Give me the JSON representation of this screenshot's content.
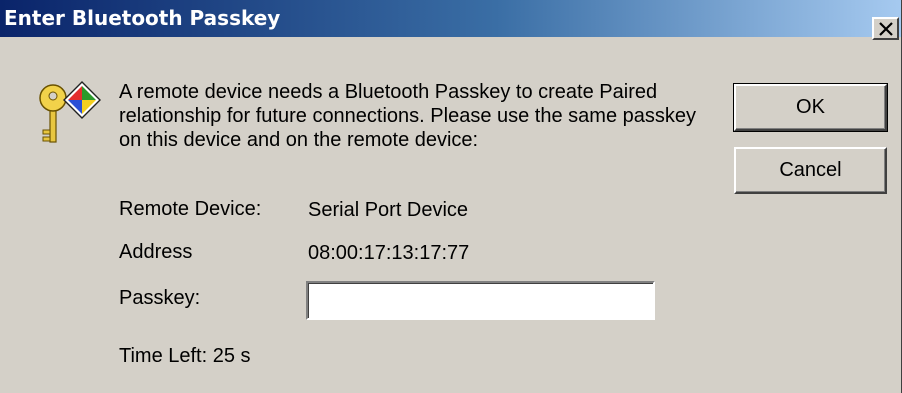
{
  "window": {
    "title": "Enter Bluetooth Passkey",
    "close_glyph": "×"
  },
  "icon": {
    "name": "keys-icon"
  },
  "message": "A remote device needs a Bluetooth Passkey to create Paired relationship for future connections. Please use the same passkey on this device and on the remote device:",
  "fields": {
    "remote_device_label": "Remote Device:",
    "remote_device_value": "Serial Port Device",
    "address_label": "Address",
    "address_value": "08:00:17:13:17:77",
    "passkey_label": "Passkey:",
    "passkey_value": ""
  },
  "time_left": "Time Left: 25 s",
  "buttons": {
    "ok": "OK",
    "cancel": "Cancel"
  },
  "colors": {
    "titlebar_start": "#0a246a",
    "titlebar_end": "#a6caf0",
    "face": "#d4d0c8"
  }
}
